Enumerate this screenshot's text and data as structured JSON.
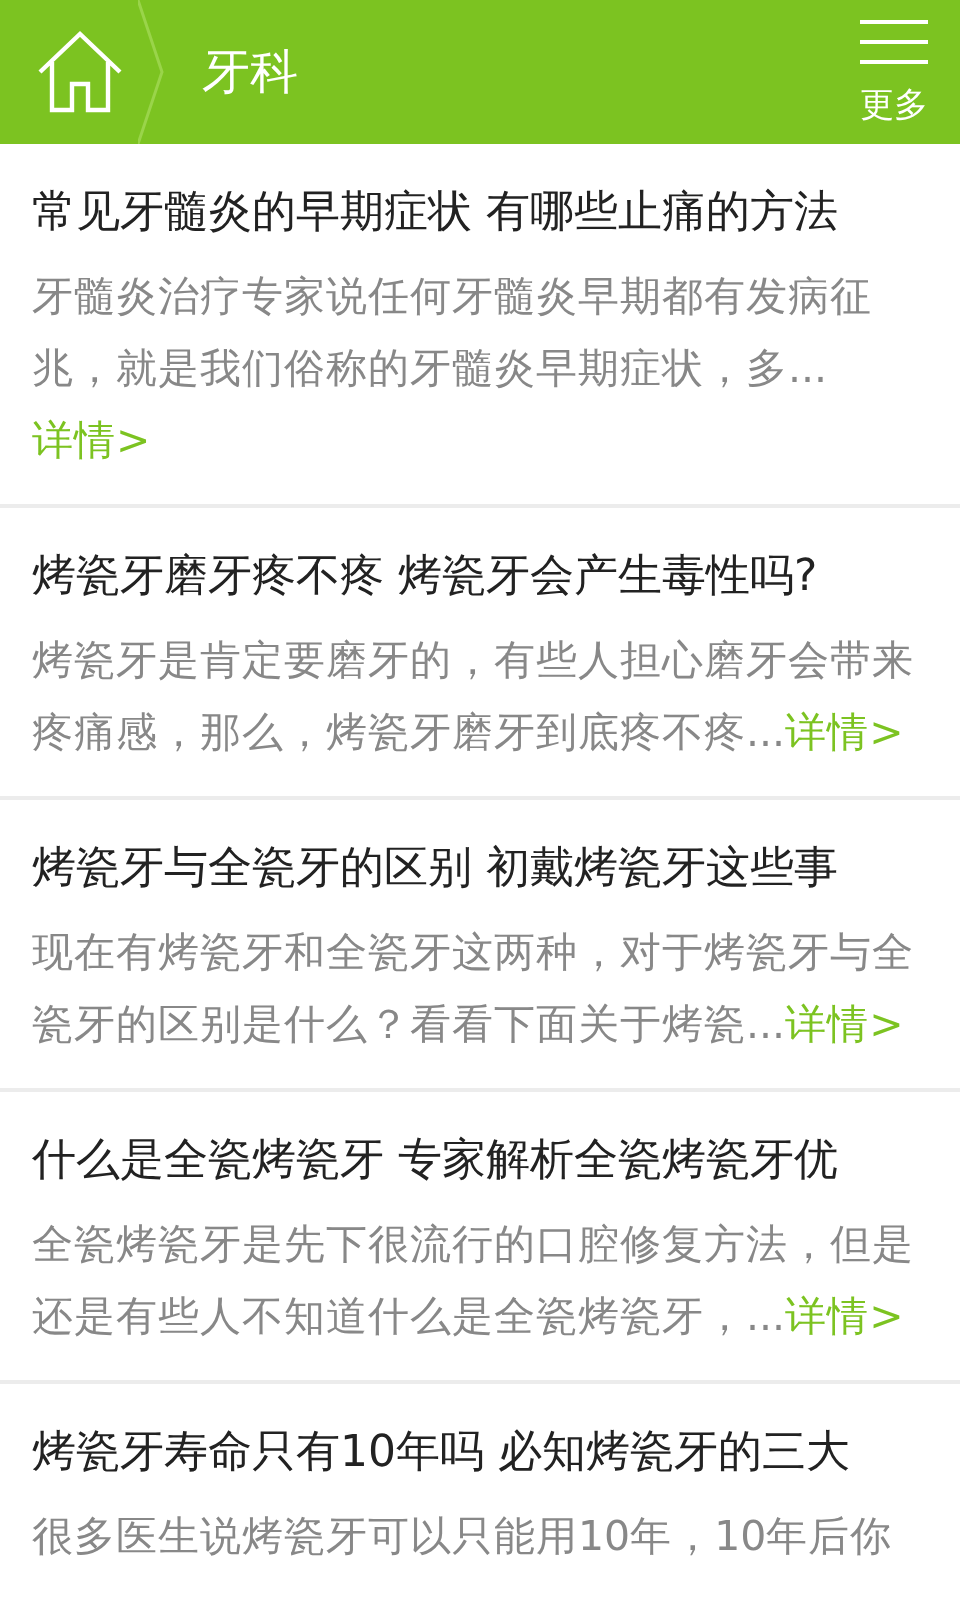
{
  "header": {
    "title": "牙科",
    "more_label": "更多"
  },
  "articles": [
    {
      "title": "常见牙髓炎的早期症状 有哪些止痛的方法",
      "summary": "牙髓炎治疗专家说任何牙髓炎早期都有发病征兆，就是我们俗称的牙髓炎早期症状，多...",
      "link": "详情>"
    },
    {
      "title": "烤瓷牙磨牙疼不疼 烤瓷牙会产生毒性吗?",
      "summary": "烤瓷牙是肯定要磨牙的，有些人担心磨牙会带来疼痛感，那么，烤瓷牙磨牙到底疼不疼...",
      "link": "详情>"
    },
    {
      "title": "烤瓷牙与全瓷牙的区别 初戴烤瓷牙这些事",
      "summary": "现在有烤瓷牙和全瓷牙这两种，对于烤瓷牙与全瓷牙的区别是什么？看看下面关于烤瓷...",
      "link": "详情>"
    },
    {
      "title": "什么是全瓷烤瓷牙 专家解析全瓷烤瓷牙优",
      "summary": "全瓷烤瓷牙是先下很流行的口腔修复方法，但是还是有些人不知道什么是全瓷烤瓷牙，...",
      "link": "详情>"
    },
    {
      "title": "烤瓷牙寿命只有10年吗 必知烤瓷牙的三大",
      "summary": "很多医生说烤瓷牙可以只能用10年，10年后你"
    }
  ]
}
